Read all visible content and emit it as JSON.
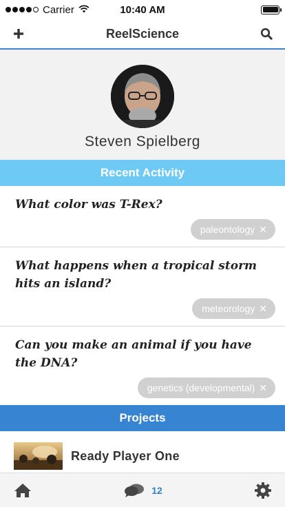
{
  "status_bar": {
    "carrier": "Carrier",
    "time": "10:40 AM",
    "signal_bars_filled": 4,
    "signal_bars_total": 5
  },
  "nav": {
    "title": "ReelScience",
    "add_icon": "plus-icon",
    "search_icon": "search-icon"
  },
  "profile": {
    "name": "Steven Spielberg"
  },
  "recent_activity": {
    "header": "Recent Activity",
    "items": [
      {
        "question": "What color was T-Rex?",
        "tag": "paleontology"
      },
      {
        "question": "What happens when a tropical storm hits an island?",
        "tag": "meteorology"
      },
      {
        "question": "Can you make an animal if you have the DNA?",
        "tag": "genetics (developmental)"
      }
    ]
  },
  "projects": {
    "header": "Projects",
    "items": [
      {
        "name": "Ready Player One"
      }
    ]
  },
  "tab_bar": {
    "comment_count": "12"
  },
  "colors": {
    "accent_blue": "#3784d3",
    "light_blue": "#6fc9f5",
    "tag_gray": "#d0d0d0",
    "count_blue": "#2f7fd0"
  }
}
